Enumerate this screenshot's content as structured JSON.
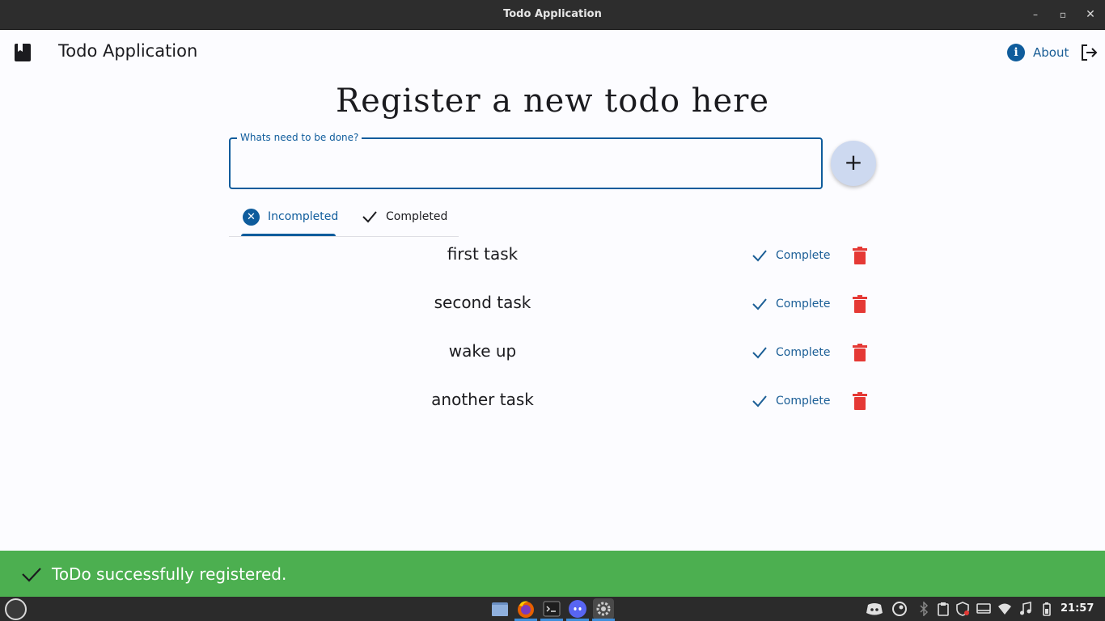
{
  "window": {
    "title": "Todo Application",
    "minimize": "–",
    "maximize": "▫",
    "close": "✕"
  },
  "appbar": {
    "title": "Todo Application",
    "about_label": "About",
    "icons": [
      "book-icon",
      "info-icon",
      "logout-icon"
    ]
  },
  "heading": "Register a new todo here",
  "input": {
    "label": "Whats need to be done?",
    "value": "",
    "placeholder": ""
  },
  "add_button": "+",
  "tabs": [
    {
      "label": "Incompleted",
      "icon": "cancel-circle-icon",
      "selected": true
    },
    {
      "label": "Completed",
      "icon": "check-icon",
      "selected": false
    }
  ],
  "todos": [
    {
      "text": "first task",
      "action": "Complete"
    },
    {
      "text": "second task",
      "action": "Complete"
    },
    {
      "text": "wake up",
      "action": "Complete"
    },
    {
      "text": "another task",
      "action": "Complete"
    }
  ],
  "snackbar": {
    "message": "ToDo successfully registered.",
    "color": "#4caf50"
  },
  "taskbar": {
    "apps": [
      "files-icon",
      "firefox-icon",
      "terminal-icon",
      "discord-icon",
      "settings-icon"
    ],
    "tray": [
      "discord-tray-icon",
      "steam-tray-icon",
      "bluetooth-icon",
      "clipboard-icon",
      "shield-icon",
      "display-icon",
      "wifi-icon",
      "music-icon",
      "battery-icon"
    ],
    "clock": "21:57"
  },
  "colors": {
    "primary": "#0f5c9c",
    "delete": "#e53935",
    "snackbar": "#4caf50",
    "fab": "#cdd9f0"
  }
}
